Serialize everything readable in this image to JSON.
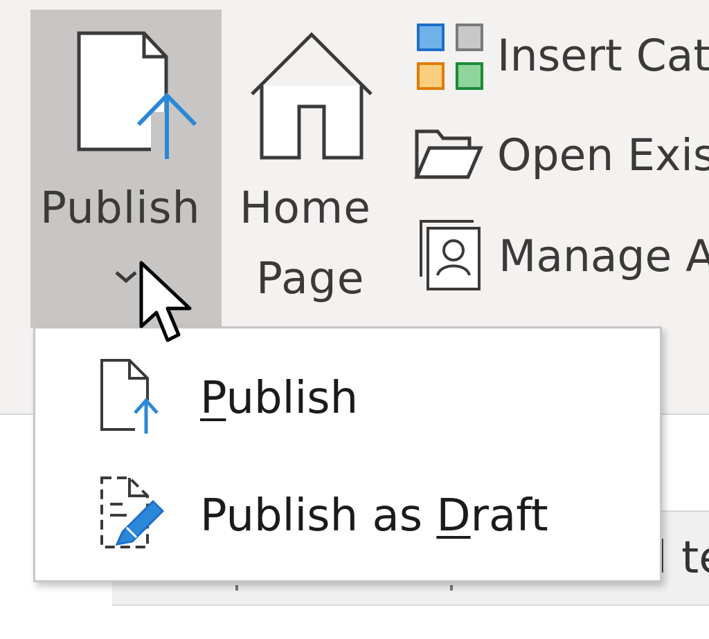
{
  "ribbon": {
    "publish_button": {
      "label": "Publish"
    },
    "home_page_button": {
      "line1": "Home",
      "line2": "Page"
    },
    "small_items": [
      {
        "label": "Insert Cat",
        "icon": "category-grid-icon"
      },
      {
        "label": "Open Exis",
        "icon": "folder-open-icon"
      },
      {
        "label": "Manage A",
        "icon": "manage-account-icon"
      }
    ]
  },
  "publish_menu": {
    "items": [
      {
        "label_pre": "",
        "label_ul": "P",
        "label_post": "ublish",
        "icon": "publish-icon"
      },
      {
        "label_pre": "Publish as ",
        "label_ul": "D",
        "label_post": "raft",
        "icon": "draft-icon"
      }
    ]
  },
  "document": {
    "ruler_text": "l te"
  },
  "colors": {
    "accent_blue": "#2b88d8",
    "ribbon_bg": "#f3f2f1",
    "pressed_bg": "#c8c6c4"
  }
}
